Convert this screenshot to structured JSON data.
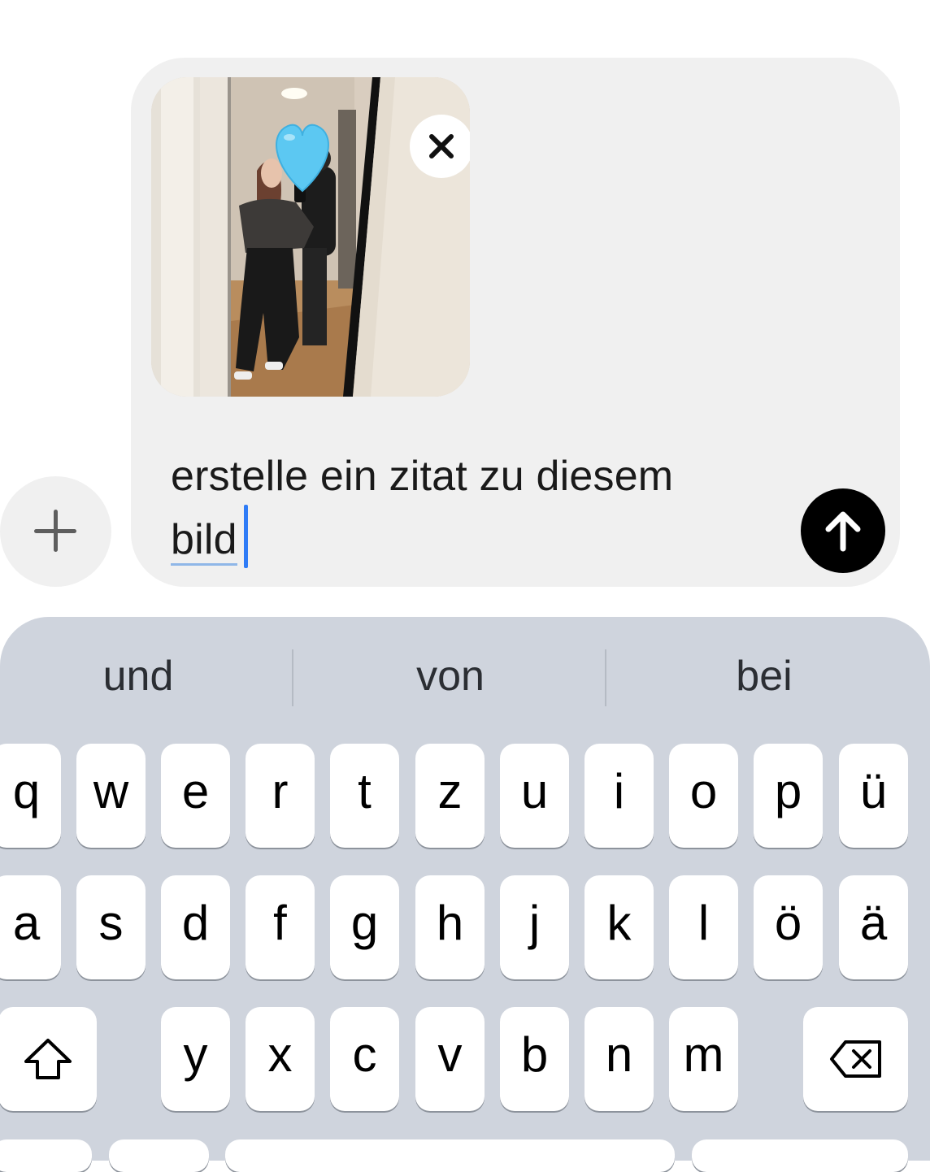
{
  "composer": {
    "message_line1": "erstelle ein zitat zu diesem",
    "message_word2": "bild",
    "attachment_icon": "photo-thumbnail",
    "remove_icon": "close-icon",
    "send_icon": "arrow-up-icon",
    "add_icon": "plus-icon"
  },
  "keyboard": {
    "suggestions": [
      "und",
      "von",
      "bei"
    ],
    "row1": [
      "q",
      "w",
      "e",
      "r",
      "t",
      "z",
      "u",
      "i",
      "o",
      "p",
      "ü"
    ],
    "row2": [
      "a",
      "s",
      "d",
      "f",
      "g",
      "h",
      "j",
      "k",
      "l",
      "ö",
      "ä"
    ],
    "row3": [
      "y",
      "x",
      "c",
      "v",
      "b",
      "n",
      "m"
    ],
    "shift_icon": "shift-icon",
    "delete_icon": "delete-icon"
  },
  "colors": {
    "accent_caret": "#2f7cf6",
    "send_button": "#000000",
    "keyboard_bg": "#cfd4dd",
    "heart": "#5cc8f2"
  }
}
